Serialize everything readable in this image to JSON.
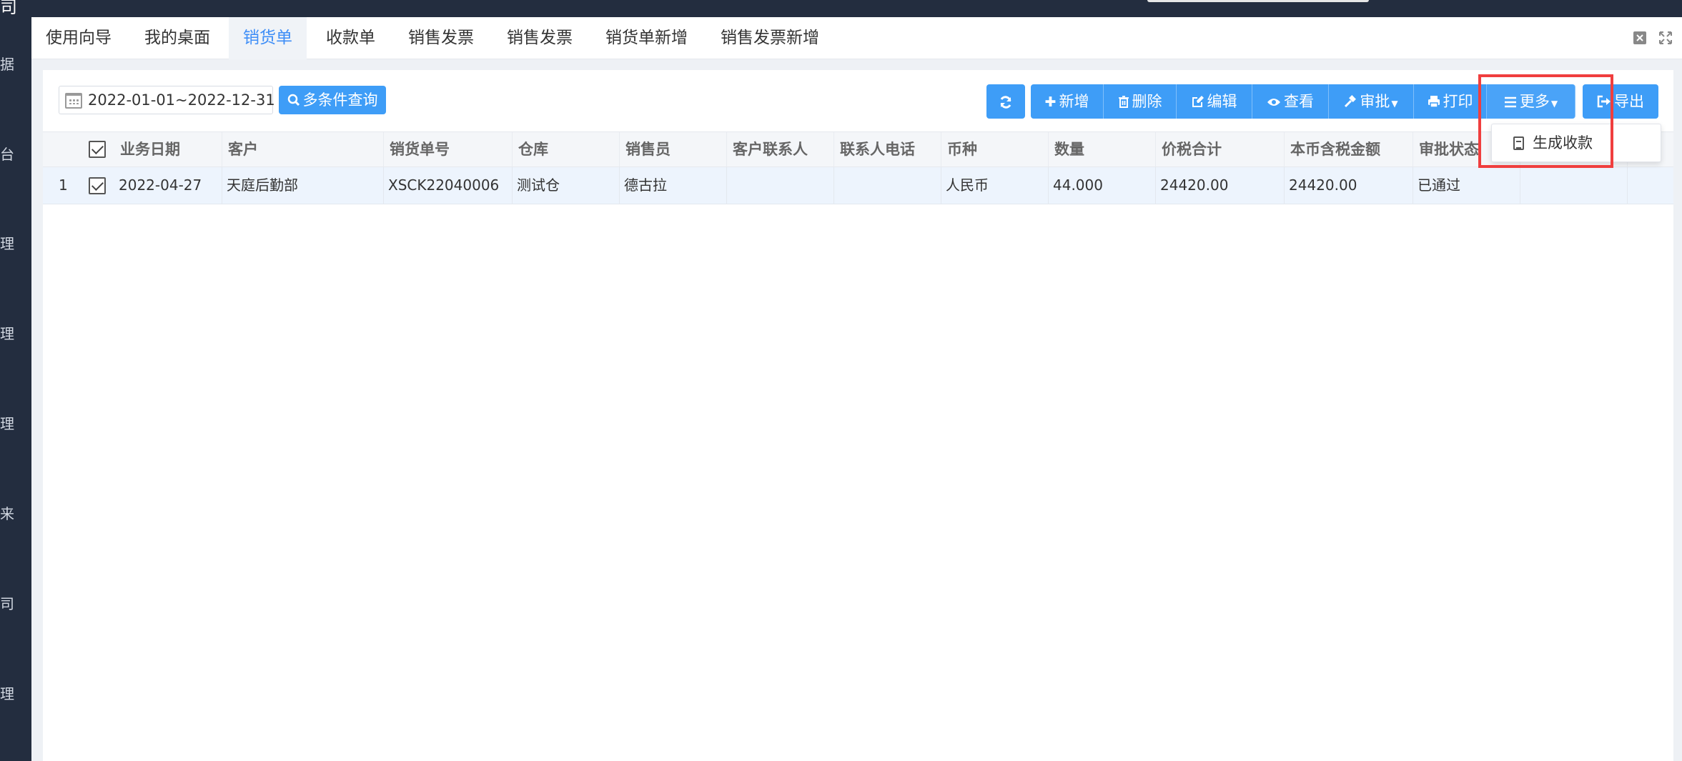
{
  "sidebar": {
    "logo_text": "司",
    "items": [
      "据",
      "台",
      "理",
      "理",
      "理",
      "来",
      "司",
      "理"
    ]
  },
  "tabs": [
    {
      "label": "使用向导",
      "active": false
    },
    {
      "label": "我的桌面",
      "active": false
    },
    {
      "label": "销货单",
      "active": true
    },
    {
      "label": "收款单",
      "active": false
    },
    {
      "label": "销售发票",
      "active": false
    },
    {
      "label": "销售发票",
      "active": false
    },
    {
      "label": "销货单新增",
      "active": false
    },
    {
      "label": "销售发票新增",
      "active": false
    }
  ],
  "tab_controls": {
    "close_icon": "close-icon",
    "fullscreen_icon": "fullscreen-icon"
  },
  "toolbar": {
    "date_range": "2022-01-01~2022-12-31",
    "query_label": "多条件查询",
    "add_label": "新增",
    "delete_label": "删除",
    "edit_label": "编辑",
    "view_label": "查看",
    "approve_label": "审批",
    "print_label": "打印",
    "more_label": "更多",
    "export_label": "导出"
  },
  "more_menu": {
    "items": [
      {
        "label": "生成收款",
        "icon": "document-icon"
      }
    ]
  },
  "table": {
    "headers": [
      "业务日期",
      "客户",
      "销货单号",
      "仓库",
      "销售员",
      "客户联系人",
      "联系人电话",
      "币种",
      "数量",
      "价税合计",
      "本币含税金额",
      "审批状态"
    ],
    "rows": [
      {
        "index": "1",
        "checked": true,
        "cells": [
          "2022-04-27",
          "天庭后勤部",
          "XSCK22040006",
          "测试仓",
          "德古拉",
          "",
          "",
          "人民币",
          "44.000",
          "24420.00",
          "24420.00",
          "已通过"
        ]
      }
    ]
  },
  "colors": {
    "accent": "#3e9df7",
    "active_tab": "#3e8ef7",
    "highlight": "#f03e3e",
    "sidebar": "#232d3f"
  }
}
